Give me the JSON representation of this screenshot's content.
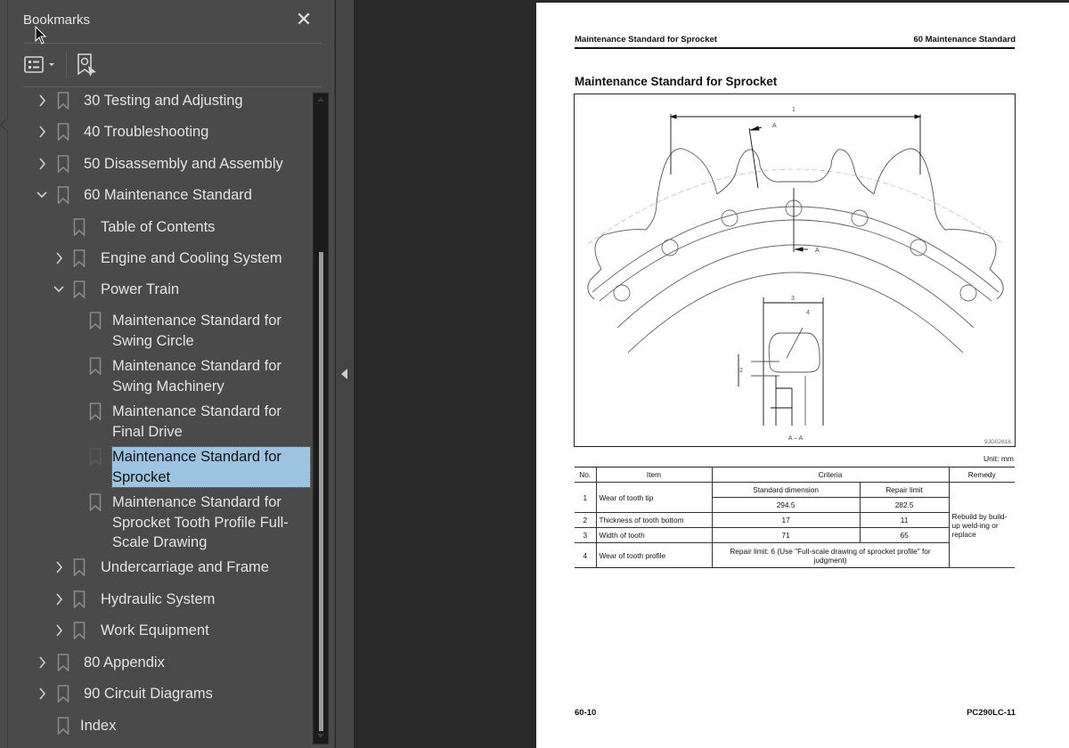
{
  "sidebar": {
    "title": "Bookmarks",
    "close_icon": "close-icon",
    "toolbar": {
      "options_icon": "list-options-icon",
      "find_icon": "find-current-bookmark-icon"
    },
    "items": [
      {
        "label": "30 Testing and Adjusting",
        "level": 0,
        "expander": "collapsed"
      },
      {
        "label": "40 Troubleshooting",
        "level": 0,
        "expander": "collapsed"
      },
      {
        "label": "50 Disassembly and Assembly",
        "level": 0,
        "expander": "collapsed"
      },
      {
        "label": "60 Maintenance Standard",
        "level": 0,
        "expander": "expanded"
      },
      {
        "label": "Table of Contents",
        "level": 1,
        "expander": "none"
      },
      {
        "label": "Engine and Cooling System",
        "level": 1,
        "expander": "collapsed"
      },
      {
        "label": "Power Train",
        "level": 1,
        "expander": "expanded"
      },
      {
        "label": " Maintenance Standard for Swing Circle",
        "level": 2,
        "expander": "none"
      },
      {
        "label": " Maintenance Standard for Swing Machinery",
        "level": 2,
        "expander": "none"
      },
      {
        "label": " Maintenance Standard for Final Drive",
        "level": 2,
        "expander": "none"
      },
      {
        "label": " Maintenance Standard for Sprocket",
        "level": 2,
        "expander": "none",
        "selected": true
      },
      {
        "label": " Maintenance Standard for Sprocket Tooth Profile Full-Scale Drawing",
        "level": 2,
        "expander": "none"
      },
      {
        "label": "Undercarriage and Frame",
        "level": 1,
        "expander": "collapsed"
      },
      {
        "label": "Hydraulic System",
        "level": 1,
        "expander": "collapsed"
      },
      {
        "label": "Work Equipment",
        "level": 1,
        "expander": "collapsed"
      },
      {
        "label": "80 Appendix",
        "level": 0,
        "expander": "collapsed"
      },
      {
        "label": "90 Circuit Diagrams",
        "level": 0,
        "expander": "collapsed"
      },
      {
        "label": "Index",
        "level": 0,
        "expander": "none"
      }
    ],
    "colors": {
      "selected_bg": "#9cc3df",
      "panel_bg": "#4a4a4a"
    }
  },
  "page": {
    "header_left": "Maintenance Standard for Sprocket",
    "header_right": "60 Maintenance Standard",
    "title": "Maintenance Standard for Sprocket",
    "figure": {
      "labels": {
        "dim1": "1",
        "dim2": "2",
        "dim3": "3",
        "dim4": "4",
        "section_mark": "A",
        "section_title": "A – A",
        "figure_id": "9JG02616"
      }
    },
    "unit": "Unit: mm",
    "table": {
      "headers": {
        "no": "No.",
        "item": "Item",
        "criteria": "Criteria",
        "remedy": "Remedy"
      },
      "sub_headers": {
        "standard": "Standard dimension",
        "repair": "Repair limit"
      },
      "rows": [
        {
          "no": "1",
          "item": "Wear of tooth tip",
          "standard": "294.5",
          "repair": "282.5"
        },
        {
          "no": "2",
          "item": "Thickness of tooth bottom",
          "standard": "17",
          "repair": "11"
        },
        {
          "no": "3",
          "item": "Width of tooth",
          "standard": "71",
          "repair": "65"
        },
        {
          "no": "4",
          "item": "Wear of tooth profile",
          "criteria_note": "Repair limit: 6 (Use \"Full-scale drawing of sprocket profile\" for judgment)"
        }
      ],
      "remedy": "Rebuild by build-up weld-ing or replace"
    },
    "footer_left": "60-10",
    "footer_right": "PC290LC-11"
  }
}
